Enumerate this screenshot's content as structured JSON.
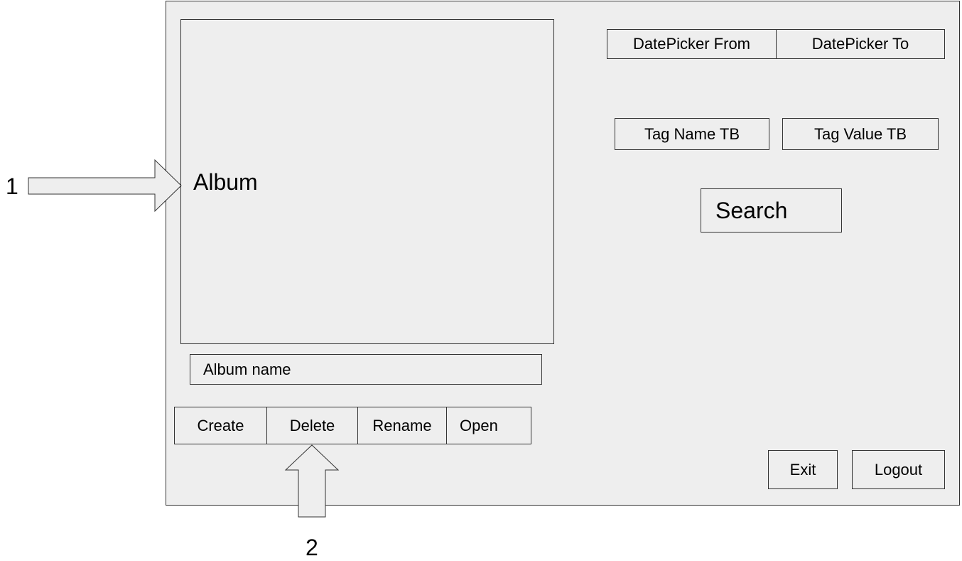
{
  "album": {
    "label": "Album"
  },
  "album_name": {
    "label": "Album name"
  },
  "album_actions": {
    "create": "Create",
    "delete": "Delete",
    "rename": "Rename",
    "open": "Open"
  },
  "dates": {
    "from": "DatePicker From",
    "to": "DatePicker To"
  },
  "tags": {
    "name": "Tag Name TB",
    "value": "Tag Value TB"
  },
  "search": {
    "label": "Search"
  },
  "footer": {
    "exit": "Exit",
    "logout": "Logout"
  },
  "annotations": {
    "one": "1",
    "two": "2"
  }
}
